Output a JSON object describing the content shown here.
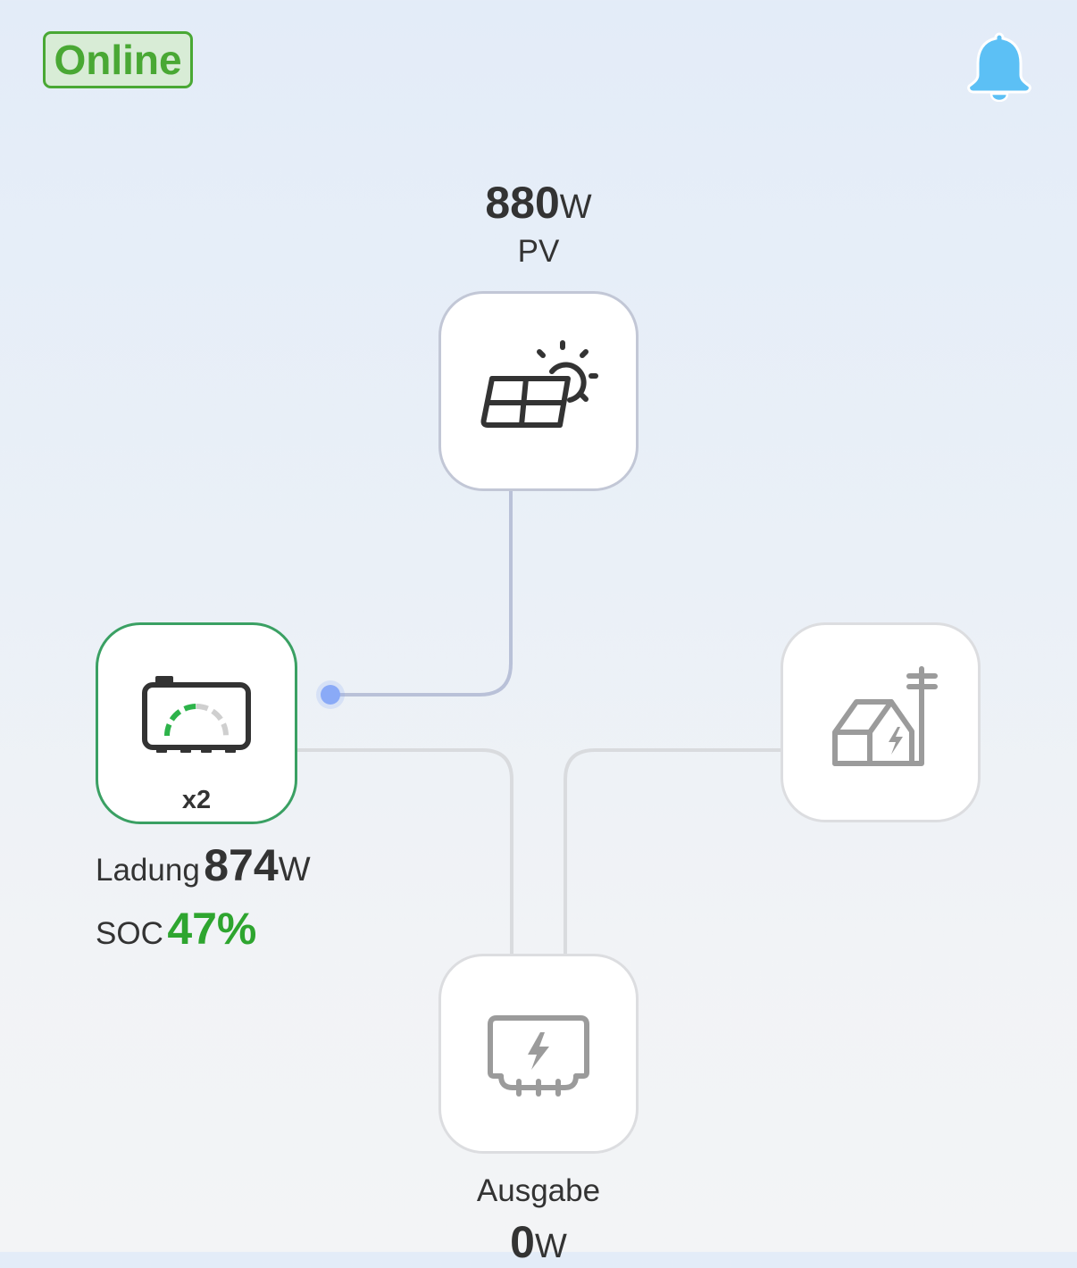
{
  "header": {
    "status_label": "Online",
    "notification_icon": "bell-icon"
  },
  "colors": {
    "status_green": "#49a834",
    "battery_border": "#3aa063",
    "soc_green": "#2ea52f",
    "bell_blue": "#5cc0f5",
    "flow_dot": "#8aaaf7"
  },
  "pv": {
    "value": "880",
    "unit": "W",
    "label": "PV",
    "icon": "solar-panel-sun-icon"
  },
  "battery": {
    "count": "x2",
    "icon": "battery-gauge-icon",
    "charge_label": "Ladung",
    "charge_value": "874",
    "charge_unit": "W",
    "soc_label": "SOC",
    "soc_value": "47%"
  },
  "grid": {
    "icon": "house-grid-icon"
  },
  "output": {
    "label": "Ausgabe",
    "value": "0",
    "unit": "W",
    "icon": "power-output-icon"
  }
}
